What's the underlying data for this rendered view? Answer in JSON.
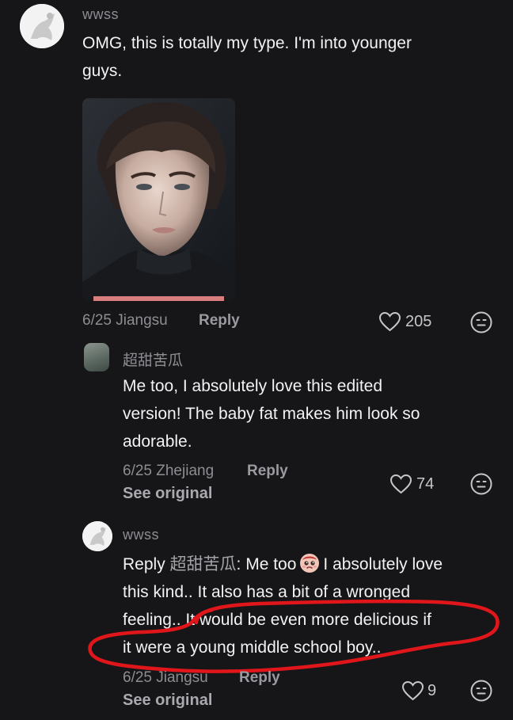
{
  "comments": [
    {
      "username": "wwss",
      "text_line1": "OMG, this is totally my type. I'm into younger",
      "text_line2": "guys.",
      "date_location": "6/25 Jiangsu",
      "reply_label": "Reply",
      "likes": "205"
    },
    {
      "username": "超甜苦瓜",
      "text_line1": "Me too, I absolutely love this edited",
      "text_line2": "version! The baby fat makes him look so",
      "text_line3": "adorable.",
      "date_location": "6/25 Zhejiang",
      "reply_label": "Reply",
      "see_original": "See original",
      "likes": "74"
    },
    {
      "username": "wwss",
      "reply_prefix": "Reply ",
      "reply_to": "超甜苦瓜",
      "text_line1_a": ": Me too",
      "text_line1_b": "I absolutely love",
      "text_line2": "this kind.. It also has a bit of a wronged",
      "text_line3": "feeling.. It would be even more delicious if",
      "text_line4": "it were a young middle school boy..",
      "date_location": "6/25 Jiangsu",
      "reply_label": "Reply",
      "see_original": "See original",
      "likes": "9"
    }
  ],
  "icons": {
    "like": "heart-outline-icon",
    "react": "neutral-face-icon",
    "inline_emoji": "pleading-face-emoji"
  },
  "colors": {
    "background": "#161619",
    "annotation": "#e0161b"
  }
}
